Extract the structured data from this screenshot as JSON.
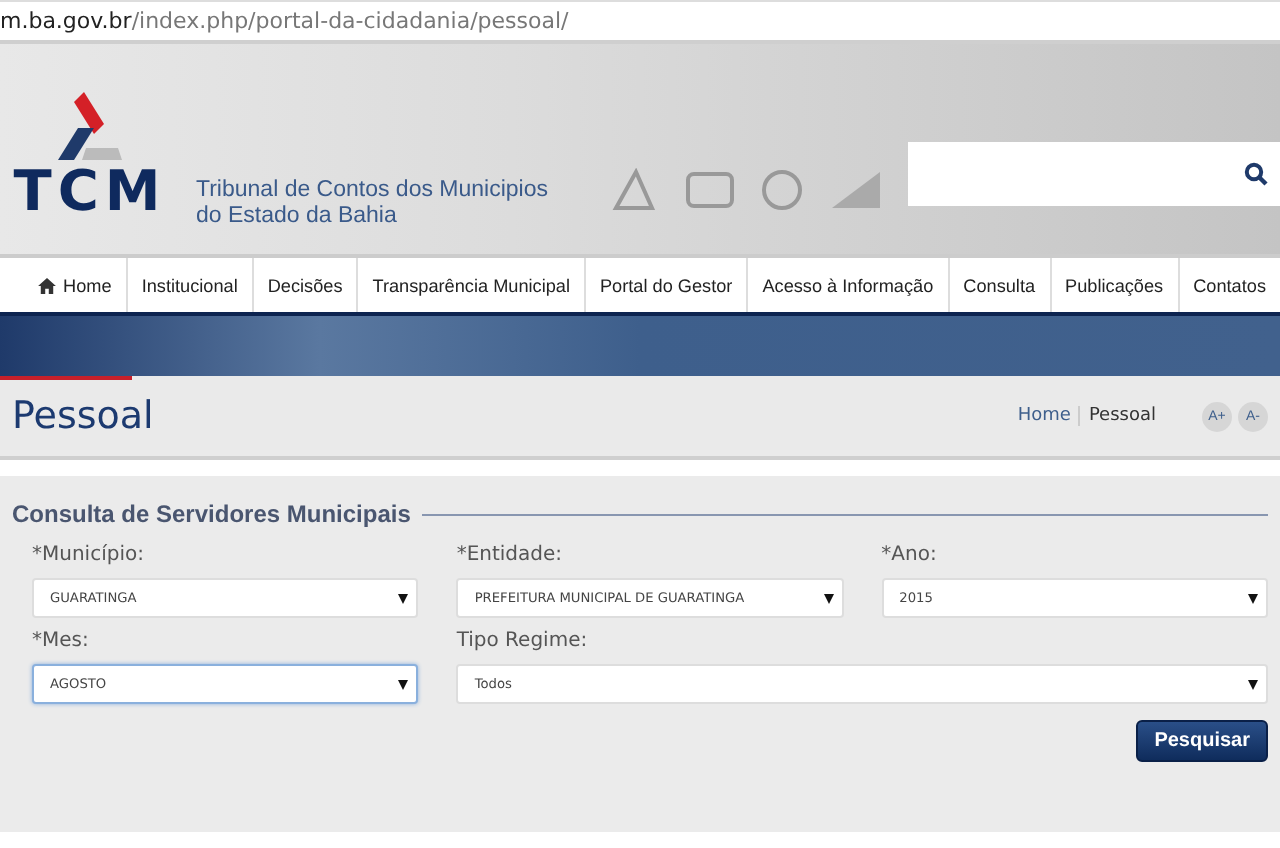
{
  "address_bar": {
    "host": "m.ba.gov.br",
    "path": "/index.php/portal-da-cidadania/pessoal/"
  },
  "header": {
    "logo_text": "TCM",
    "org_name": [
      "Tribunal de Contos dos Municipios",
      "do Estado da Bahia"
    ]
  },
  "nav": [
    {
      "label": "Home",
      "kind": "home"
    },
    {
      "label": "Institucional",
      "kind": "plain"
    },
    {
      "label": "Decisões",
      "kind": "plain"
    },
    {
      "label": "Transparência Municipal",
      "kind": "plain"
    },
    {
      "label": "Portal do Gestor",
      "kind": "plain"
    },
    {
      "label": "Acesso à Informação",
      "kind": "plain"
    },
    {
      "label": "Consulta",
      "kind": "plain"
    },
    {
      "label": "Publicações",
      "kind": "plain"
    },
    {
      "label": "Contatos",
      "kind": "plain"
    }
  ],
  "page_title": "Pessoal",
  "breadcrumb": [
    {
      "label": "Home",
      "kind": "link"
    },
    {
      "label": "Pessoal",
      "kind": "current"
    }
  ],
  "font_buttons": [
    "A+",
    "A-"
  ],
  "form": {
    "legend": "Consulta de Servidores Municipais",
    "rows": [
      [
        {
          "label": "*Município:",
          "value": "GUARATINGA",
          "focused": false
        },
        {
          "label": "*Entidade:",
          "value": "PREFEITURA MUNICIPAL DE GUARATINGA",
          "focused": false
        },
        {
          "label": "*Ano:",
          "value": "2015",
          "focused": false
        }
      ],
      [
        {
          "label": "*Mes:",
          "value": "AGOSTO",
          "focused": true
        },
        {
          "label": "Tipo Regime:",
          "value": "Todos",
          "focused": false
        }
      ]
    ],
    "submit": "Pesquisar"
  }
}
